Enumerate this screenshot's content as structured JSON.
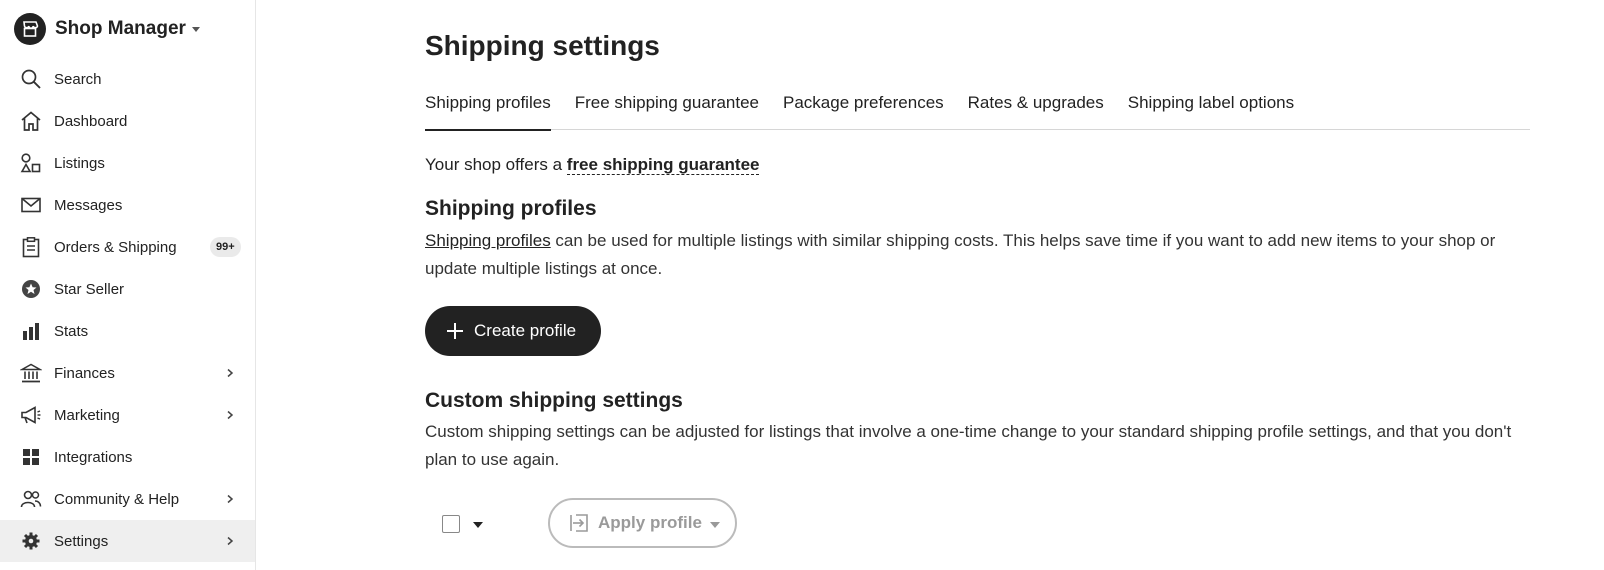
{
  "brand": {
    "title": "Shop Manager"
  },
  "sidebar": {
    "items": [
      {
        "label": "Search",
        "icon": "search-icon"
      },
      {
        "label": "Dashboard",
        "icon": "home-icon"
      },
      {
        "label": "Listings",
        "icon": "listings-icon"
      },
      {
        "label": "Messages",
        "icon": "envelope-icon"
      },
      {
        "label": "Orders & Shipping",
        "icon": "clipboard-icon",
        "badge": "99+"
      },
      {
        "label": "Star Seller",
        "icon": "star-badge-icon"
      },
      {
        "label": "Stats",
        "icon": "bar-chart-icon"
      },
      {
        "label": "Finances",
        "icon": "bank-icon"
      },
      {
        "label": "Marketing",
        "icon": "megaphone-icon"
      },
      {
        "label": "Integrations",
        "icon": "grid-icon"
      },
      {
        "label": "Community & Help",
        "icon": "people-icon"
      },
      {
        "label": "Settings",
        "icon": "gear-icon"
      }
    ]
  },
  "page": {
    "title": "Shipping settings"
  },
  "tabs": [
    {
      "label": "Shipping profiles",
      "active": true
    },
    {
      "label": "Free shipping guarantee"
    },
    {
      "label": "Package preferences"
    },
    {
      "label": "Rates & upgrades"
    },
    {
      "label": "Shipping label options"
    }
  ],
  "guarantee": {
    "prefix": "Your shop offers a ",
    "link": "free shipping guarantee"
  },
  "profiles": {
    "title": "Shipping profiles",
    "link": "Shipping profiles",
    "text": " can be used for multiple listings with similar shipping costs. This helps save time if you want to add new items to your shop or update multiple listings at once.",
    "create_label": "Create profile"
  },
  "custom": {
    "title": "Custom shipping settings",
    "text": "Custom shipping settings can be adjusted for listings that involve a one-time change to your standard shipping profile settings, and that you don't plan to use again.",
    "apply_label": "Apply profile"
  },
  "colors": {
    "text": "#222222",
    "active_bg": "#efefef",
    "disabled": "#9a9a9a"
  }
}
